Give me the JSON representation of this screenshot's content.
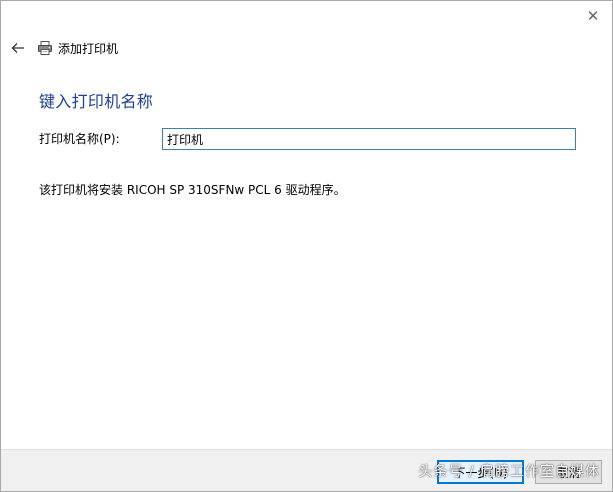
{
  "window": {
    "title": "添加打印机",
    "close_glyph": "✕"
  },
  "main": {
    "heading": "键入打印机名称",
    "printer_name_label": "打印机名称(P):",
    "printer_name_value": "打印机",
    "driver_info": "该打印机将安装 RICOH SP 310SFNw PCL 6 驱动程序。"
  },
  "footer": {
    "next_label": "下一步(N)",
    "cancel_label": "取消"
  },
  "watermark": "头条号 / 肩膀工作室自媒体",
  "colors": {
    "heading": "#1e3f9c",
    "input_border": "#3c7fb1",
    "primary_button_border": "#0078d7",
    "footer_bg": "#f0f0f0"
  },
  "icons": {
    "back": "back-arrow-icon",
    "printer": "printer-icon",
    "close": "close-icon"
  }
}
